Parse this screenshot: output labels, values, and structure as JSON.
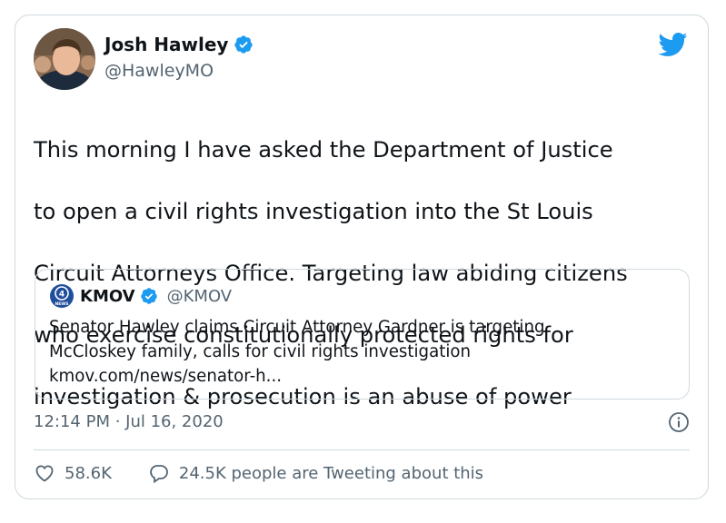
{
  "author": {
    "name": "Josh Hawley",
    "handle": "@HawleyMO"
  },
  "tweet": {
    "lines": [
      "This morning I have asked the Department of Justice",
      "to open a civil rights investigation into the St Louis",
      "Circuit Attorneys Office. Targeting law abiding citizens",
      "who exercise constitutionally protected rights for",
      "investigation & prosecution is an abuse of power"
    ],
    "timestamp": "12:14 PM · Jul 16, 2020"
  },
  "quoted": {
    "name": "KMOV",
    "handle": "@KMOV",
    "logo_text": "4",
    "logo_subtext": "NEWS",
    "lines": [
      "Senator Hawley claims Circuit Attorney Gardner is targeting",
      "McCloskey family, calls for civil rights investigation",
      "kmov.com/news/senator-h..."
    ]
  },
  "stats": {
    "likes": "58.6K",
    "tweeting": "24.5K people are Tweeting about this"
  },
  "icons": {
    "verified": "verified-badge-icon",
    "bird": "twitter-bird-icon",
    "info": "info-icon",
    "like": "heart-icon",
    "reply": "speech-bubble-icon"
  },
  "colors": {
    "brand_blue": "#1d9bf0",
    "text": "#0f1419",
    "secondary": "#536471",
    "border": "#cfd9de"
  }
}
